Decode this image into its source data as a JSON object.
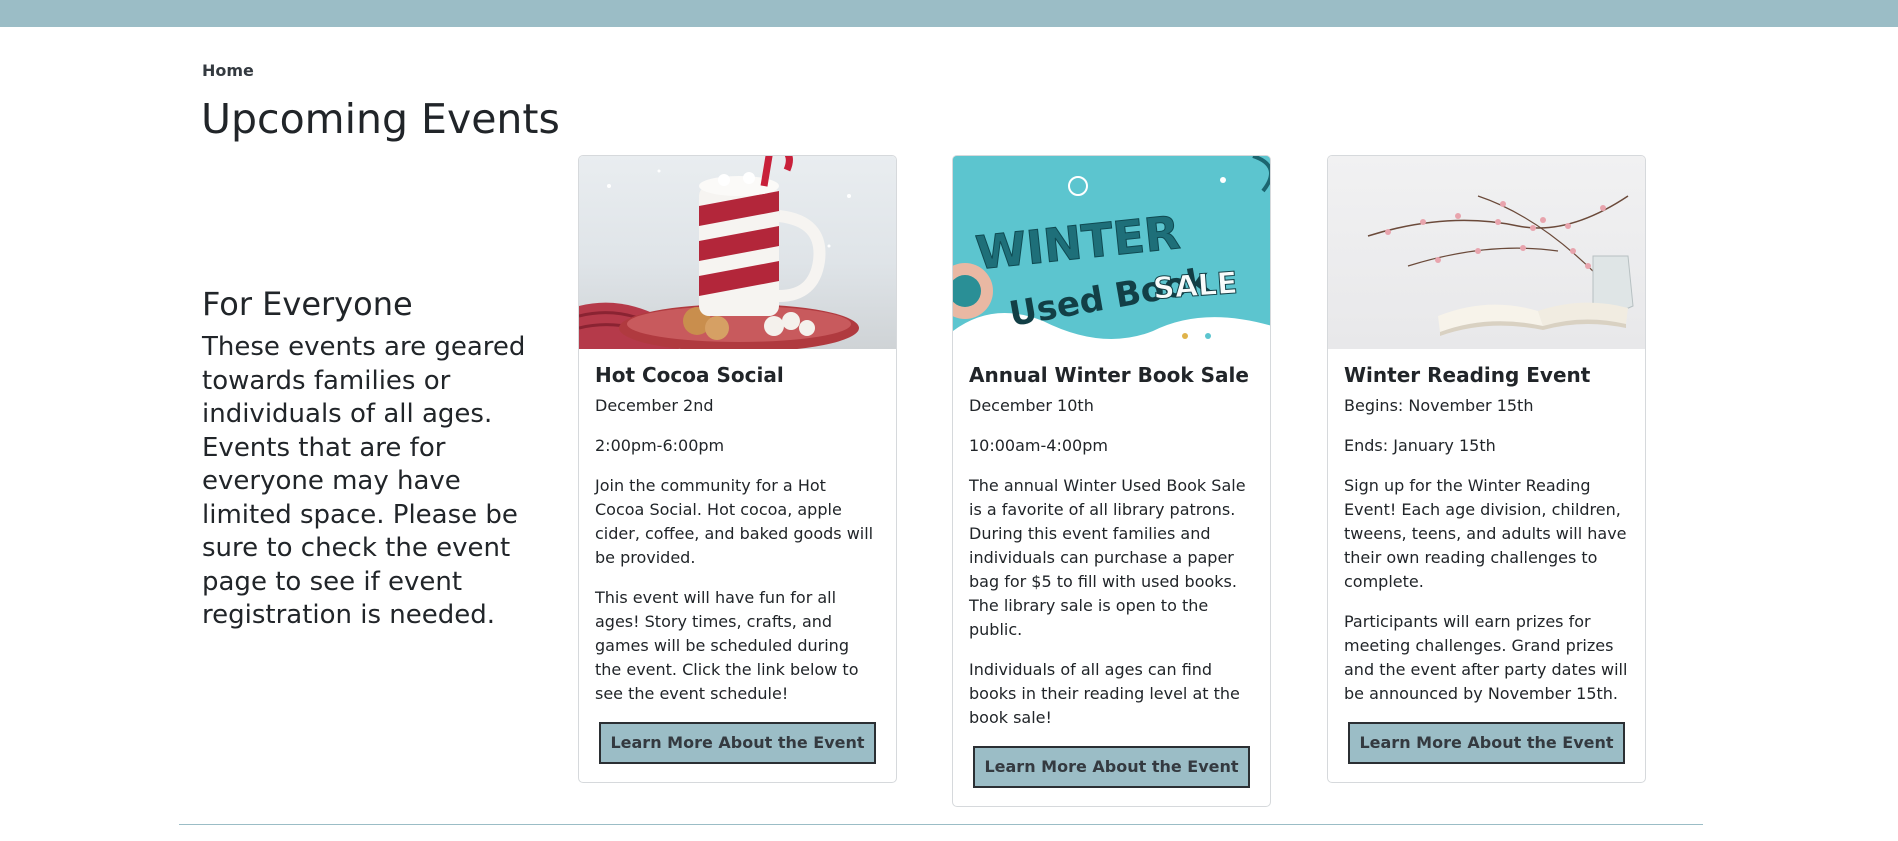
{
  "header": {
    "breadcrumb": "Home",
    "title": "Upcoming Events"
  },
  "intro": {
    "heading": "For Everyone",
    "text": "These events are geared towards families or individuals of all ages. Events that are for everyone may have limited space. Please be sure to check the event page to see if event registration is needed."
  },
  "events": [
    {
      "title": "Hot Cocoa Social",
      "line1": "December 2nd",
      "line2": "2:00pm-6:00pm",
      "desc1": "Join the community for a Hot Cocoa Social. Hot cocoa, apple cider, coffee, and baked goods will be provided.",
      "desc2": "This event will have fun for all ages! Story times, crafts, and games will be scheduled during the event. Click the link below to see the event schedule!",
      "button": "Learn More About the Event",
      "image": "hot-cocoa-mug-image"
    },
    {
      "title": "Annual Winter Book Sale",
      "line1": "December 10th",
      "line2": "10:00am-4:00pm",
      "desc1": "The annual Winter Used Book Sale is a favorite of all library patrons. During this event families and individuals can purchase a paper bag for $5 to fill with used books. The library sale is open to the public.",
      "desc2": "Individuals of all ages can find books in their reading level at the book sale!",
      "button": "Learn More About the Event",
      "image": "winter-book-sale-banner",
      "image_text": {
        "word1": "WINTER",
        "word2": "Used Book",
        "word3": "SALE"
      }
    },
    {
      "title": "Winter Reading Event",
      "line1": "Begins: November 15th",
      "line2": "Ends: January 15th",
      "desc1": "Sign up for the Winter Reading Event! Each age division, children, tweens, teens, and adults will have their own reading challenges to complete.",
      "desc2": "Participants will earn prizes for meeting challenges. Grand prizes and the event after party dates will be announced by November 15th.",
      "button": "Learn More About the Event",
      "image": "book-and-blossom-branches-image"
    }
  ],
  "colors": {
    "accent": "#9bbdc6",
    "text": "#212529",
    "border": "#d6d9dc"
  }
}
